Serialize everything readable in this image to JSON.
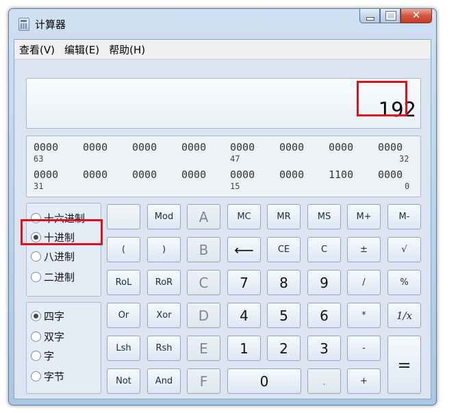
{
  "window": {
    "title": "计算器"
  },
  "menu": [
    "查看(V)",
    "编辑(E)",
    "帮助(H)"
  ],
  "display": {
    "value": "192"
  },
  "binary": {
    "row1": [
      "0000",
      "0000",
      "0000",
      "0000",
      "0000",
      "0000",
      "0000",
      "0000"
    ],
    "row1_labels": [
      "63",
      "47",
      "32"
    ],
    "row2": [
      "0000",
      "0000",
      "0000",
      "0000",
      "0000",
      "0000",
      "1100",
      "0000"
    ],
    "row2_labels": [
      "31",
      "15",
      "0"
    ]
  },
  "base_options": [
    {
      "label": "十六进制",
      "selected": false
    },
    {
      "label": "十进制",
      "selected": true
    },
    {
      "label": "八进制",
      "selected": false
    },
    {
      "label": "二进制",
      "selected": false
    }
  ],
  "word_options": [
    {
      "label": "四字",
      "selected": true
    },
    {
      "label": "双字",
      "selected": false
    },
    {
      "label": "字",
      "selected": false
    },
    {
      "label": "字节",
      "selected": false
    }
  ],
  "keys": {
    "mod": "Mod",
    "a": "A",
    "mc": "MC",
    "mr": "MR",
    "ms": "MS",
    "mplus": "M+",
    "mminus": "M-",
    "lparen": "(",
    "rparen": ")",
    "b": "B",
    "back": "⟵",
    "ce": "CE",
    "c": "C",
    "plusminus": "±",
    "sqrt": "√",
    "rol": "RoL",
    "ror": "RoR",
    "hc": "C",
    "n7": "7",
    "n8": "8",
    "n9": "9",
    "div": "/",
    "pct": "%",
    "or": "Or",
    "xor": "Xor",
    "d": "D",
    "n4": "4",
    "n5": "5",
    "n6": "6",
    "mul": "*",
    "recip": "1/x",
    "lsh": "Lsh",
    "rsh": "Rsh",
    "e": "E",
    "n1": "1",
    "n2": "2",
    "n3": "3",
    "minus": "-",
    "eq": "=",
    "not": "Not",
    "and": "And",
    "f": "F",
    "n0": "0",
    "dot": ".",
    "plus": "+"
  }
}
